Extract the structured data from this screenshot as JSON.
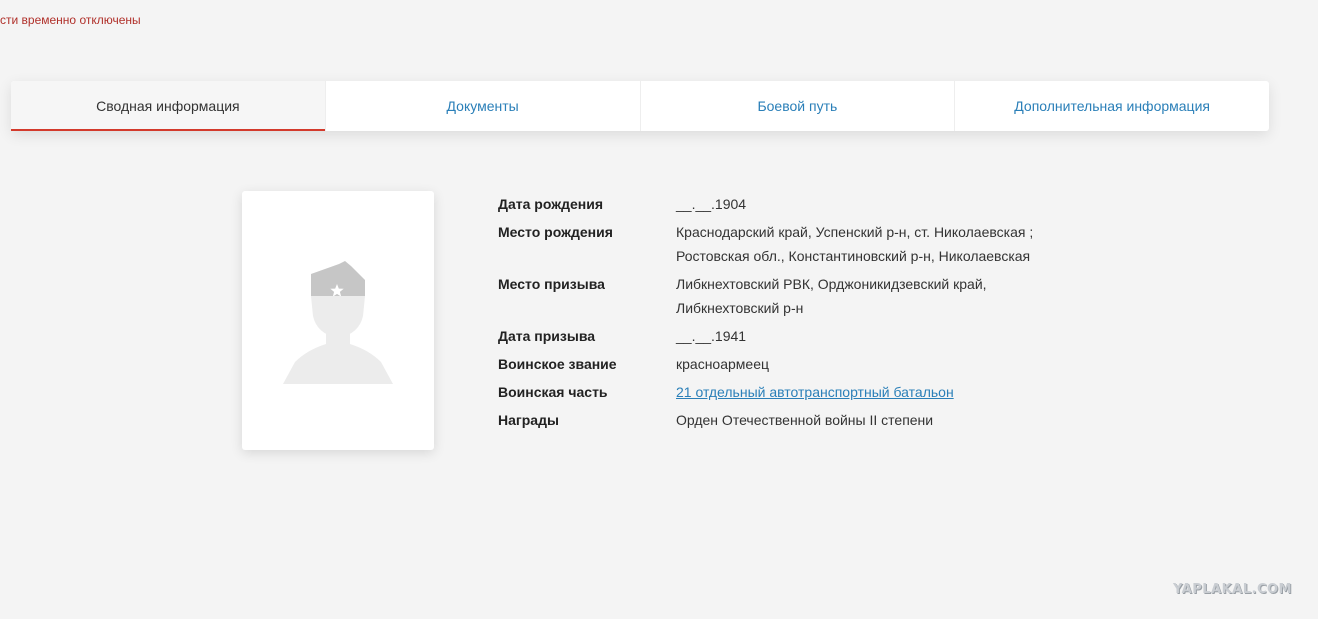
{
  "notice": {
    "text": "сти временно отключены"
  },
  "tabs": [
    {
      "label": "Сводная информация",
      "active": true
    },
    {
      "label": "Документы",
      "active": false
    },
    {
      "label": "Боевой путь",
      "active": false
    },
    {
      "label": "Дополнительная информация",
      "active": false
    }
  ],
  "photo": {
    "icon": "soldier-silhouette-icon"
  },
  "info": {
    "birth_date": {
      "label": "Дата рождения",
      "value": "__.__.1904"
    },
    "birth_place": {
      "label": "Место рождения",
      "value": "Краснодарский край, Успенский р-н, ст. Николаевская ; Ростовская обл., Константиновский р-н, Николаевская"
    },
    "draft_place": {
      "label": "Место призыва",
      "value": "Либкнехтовский РВК, Орджоникидзевский край, Либкнехтовский р-н"
    },
    "draft_date": {
      "label": "Дата призыва",
      "value": "__.__.1941"
    },
    "rank": {
      "label": "Воинское звание",
      "value": "красноармеец"
    },
    "unit": {
      "label": "Воинская часть",
      "value": "21 отдельный автотранспортный батальон"
    },
    "awards": {
      "label": "Награды",
      "value": "Орден Отечественной войны II степени"
    }
  },
  "watermark": {
    "text": "YAPLAKAL.COM"
  },
  "colors": {
    "accent": "#d33a2c",
    "link": "#2a7fb8",
    "notice": "#b0302a",
    "background": "#f4f4f4"
  }
}
